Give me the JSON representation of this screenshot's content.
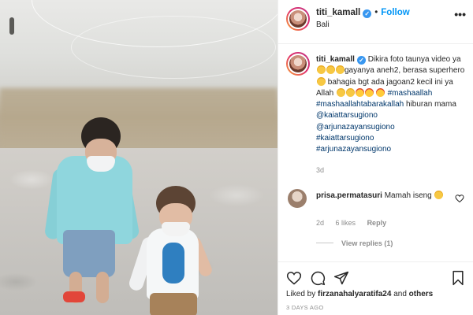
{
  "post": {
    "username": "titi_kamall",
    "location": "Bali",
    "follow_label": "Follow",
    "more_icon": "ellipsis-icon"
  },
  "caption": {
    "username": "titi_kamall",
    "text_1": "Dikira foto taunya video ya",
    "text_2": "gayanya aneh2, berasa superhero",
    "text_3": "bahagia bgt ada jagoan2 kecil ini ya Allah",
    "hashtags": [
      "#mashaallah",
      "#mashaallahtabarakallah"
    ],
    "text_4": "hiburan mama",
    "mentions": [
      "@kaiattarsugiono",
      "@arjunazayansugiono"
    ],
    "hashtags_2": [
      "#kaiattarsugiono",
      "#arjunazayansugiono"
    ],
    "time": "3d"
  },
  "comment": {
    "username": "prisa.permatasuri",
    "text": "Mamah iseng",
    "time": "2d",
    "likes": "6 likes",
    "reply_label": "Reply",
    "view_replies": "View replies (1)"
  },
  "footer": {
    "liked_by_prefix": "Liked by",
    "liked_by_user": "firzanahalyaratifa24",
    "liked_by_suffix": "and",
    "liked_by_others": "others",
    "time_ago": "3 DAYS AGO"
  },
  "icons": [
    "heart-icon",
    "comment-icon",
    "share-icon",
    "bookmark-icon",
    "verified-icon"
  ],
  "colors": {
    "link": "#0095f6",
    "hashtag": "#00376b",
    "muted": "#8e8e8e",
    "verified": "#3897f0"
  }
}
